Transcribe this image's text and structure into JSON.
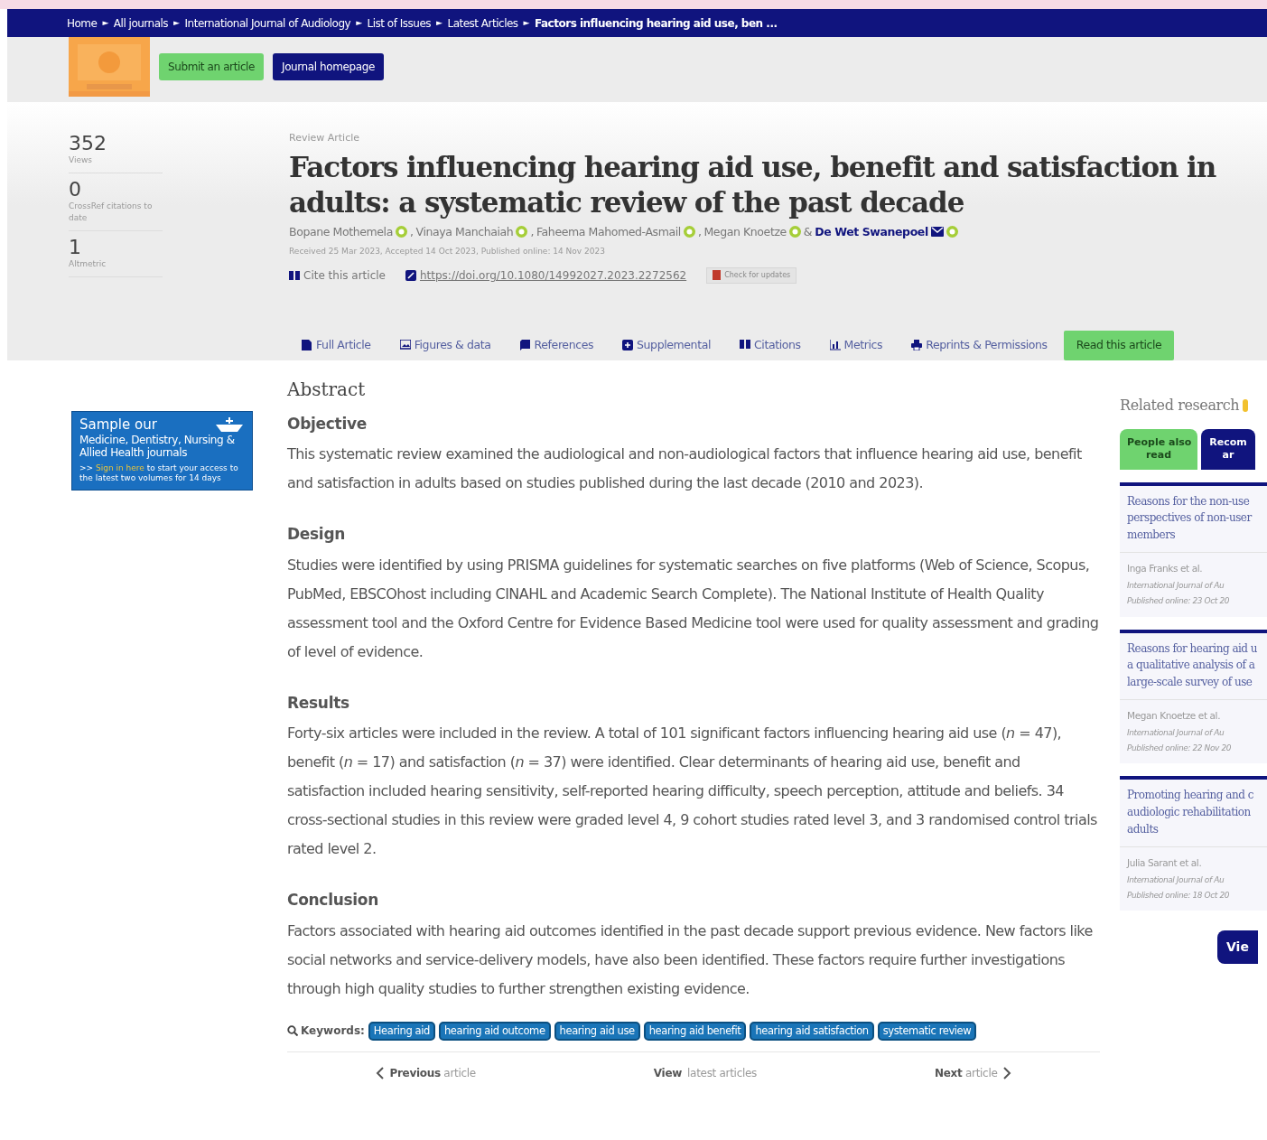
{
  "breadcrumb": {
    "separator": "►",
    "items": [
      {
        "label": "Home",
        "current": false
      },
      {
        "label": "All journals",
        "current": false
      },
      {
        "label": "International Journal of Audiology",
        "current": false
      },
      {
        "label": "List of Issues",
        "current": false
      },
      {
        "label": "Latest Articles",
        "current": false
      },
      {
        "label": "Factors influencing hearing aid use, ben ...",
        "current": true
      }
    ]
  },
  "header": {
    "buttons": [
      {
        "label": "Submit an article",
        "kind": "green"
      },
      {
        "label": "Journal homepage",
        "kind": "navy"
      }
    ]
  },
  "metrics": [
    {
      "value": "352",
      "label": "Views"
    },
    {
      "value": "0",
      "label": "CrossRef citations to date"
    },
    {
      "value": "1",
      "label": "Altmetric"
    }
  ],
  "article": {
    "type": "Review Article",
    "title": "Factors influencing hearing aid use, benefit and satisfaction in adults: a systematic review of the past decade",
    "authors": [
      {
        "name": "Bopane Mothemela",
        "corresponding": false,
        "sep": ","
      },
      {
        "name": "Vinaya Manchaiah",
        "corresponding": false,
        "sep": ","
      },
      {
        "name": "Faheema Mahomed-Asmail",
        "corresponding": false,
        "sep": ","
      },
      {
        "name": "Megan Knoetze",
        "corresponding": false,
        "sep": "&"
      },
      {
        "name": "De Wet Swanepoel",
        "corresponding": true
      }
    ],
    "dates": "Received 25 Mar 2023, Accepted 14 Oct 2023, Published online: 14 Nov 2023",
    "cite": "Cite this article",
    "doi": "https://doi.org/10.1080/14992027.2023.2272562",
    "updates": "Check for updates"
  },
  "tabs": [
    {
      "label": "Full Article"
    },
    {
      "label": "Figures & data"
    },
    {
      "label": "References"
    },
    {
      "label": "Supplemental"
    },
    {
      "label": "Citations"
    },
    {
      "label": "Metrics"
    },
    {
      "label": "Reprints & Permissions"
    }
  ],
  "read_button": "Read this article",
  "ad": {
    "title": "Sample our",
    "subtitle": "Medicine, Dentistry, Nursing & Allied Health journals",
    "lead": ">>",
    "link": "Sign in here",
    "rest": "to start your access to the latest two volumes for 14 days"
  },
  "abstract": {
    "heading": "Abstract",
    "sections": [
      {
        "heading": "Objective",
        "text": "This systematic review examined the audiological and non-audiological factors that influence hearing aid use, benefit and satisfaction in adults based on studies published during the last decade (2010 and 2023)."
      },
      {
        "heading": "Design",
        "text": "Studies were identified by using PRISMA guidelines for systematic searches on five platforms (Web of Science, Scopus, PubMed, EBSCOhost including CINAHL and Academic Search Complete). The National Institute of Health Quality assessment tool and the Oxford Centre for Evidence Based Medicine tool were used for quality assessment and grading of level of evidence."
      },
      {
        "heading": "Results",
        "text": "Forty-six articles were included in the review. A total of 101 significant factors influencing hearing aid use (*n* = 47), benefit (*n* = 17) and satisfaction (*n* = 37) were identified. Clear determinants of hearing aid use, benefit and satisfaction included hearing sensitivity, self-reported hearing difficulty, speech perception, attitude and beliefs. 34 cross-sectional studies in this review were graded level 4, 9 cohort studies rated level 3, and 3 randomised control trials rated level 2."
      },
      {
        "heading": "Conclusion",
        "text": "Factors associated with hearing aid outcomes identified in the past decade support previous evidence. New factors like social networks and service-delivery models, have also been identified. These factors require further investigations through high quality studies to further strengthen existing evidence."
      }
    ]
  },
  "keywords": {
    "label": "Keywords:",
    "items": [
      "Hearing aid",
      "hearing aid outcome",
      "hearing aid use",
      "hearing aid benefit",
      "hearing aid satisfaction",
      "systematic review"
    ]
  },
  "pager": {
    "previous": "**Previous** article",
    "latest": "**View** latest articles",
    "next": "**Next** article"
  },
  "related": {
    "heading": "Related research",
    "tabs": [
      {
        "lines": [
          "People also",
          "read"
        ],
        "selected": true
      },
      {
        "lines": [
          "Recom",
          "ar"
        ],
        "selected": false
      }
    ],
    "items": [
      {
        "title_lines": [
          "Reasons for the non-use",
          "perspectives of non-user",
          "members"
        ],
        "authors": "Inga Franks et al.",
        "journal": "International Journal of Au",
        "published": "Published online: 23 Oct 20"
      },
      {
        "title_lines": [
          "Reasons for hearing aid u",
          "a qualitative analysis of a",
          "large-scale survey of use"
        ],
        "authors": "Megan Knoetze et al.",
        "journal": "International Journal of Au",
        "published": "Published online: 22 Nov 20"
      },
      {
        "title_lines": [
          "Promoting hearing and c",
          "audiologic rehabilitation",
          "adults"
        ],
        "authors": "Julia Sarant et al.",
        "journal": "International Journal of Au",
        "published": "Published online: 18 Oct 20"
      }
    ],
    "view_button": "Vie"
  }
}
